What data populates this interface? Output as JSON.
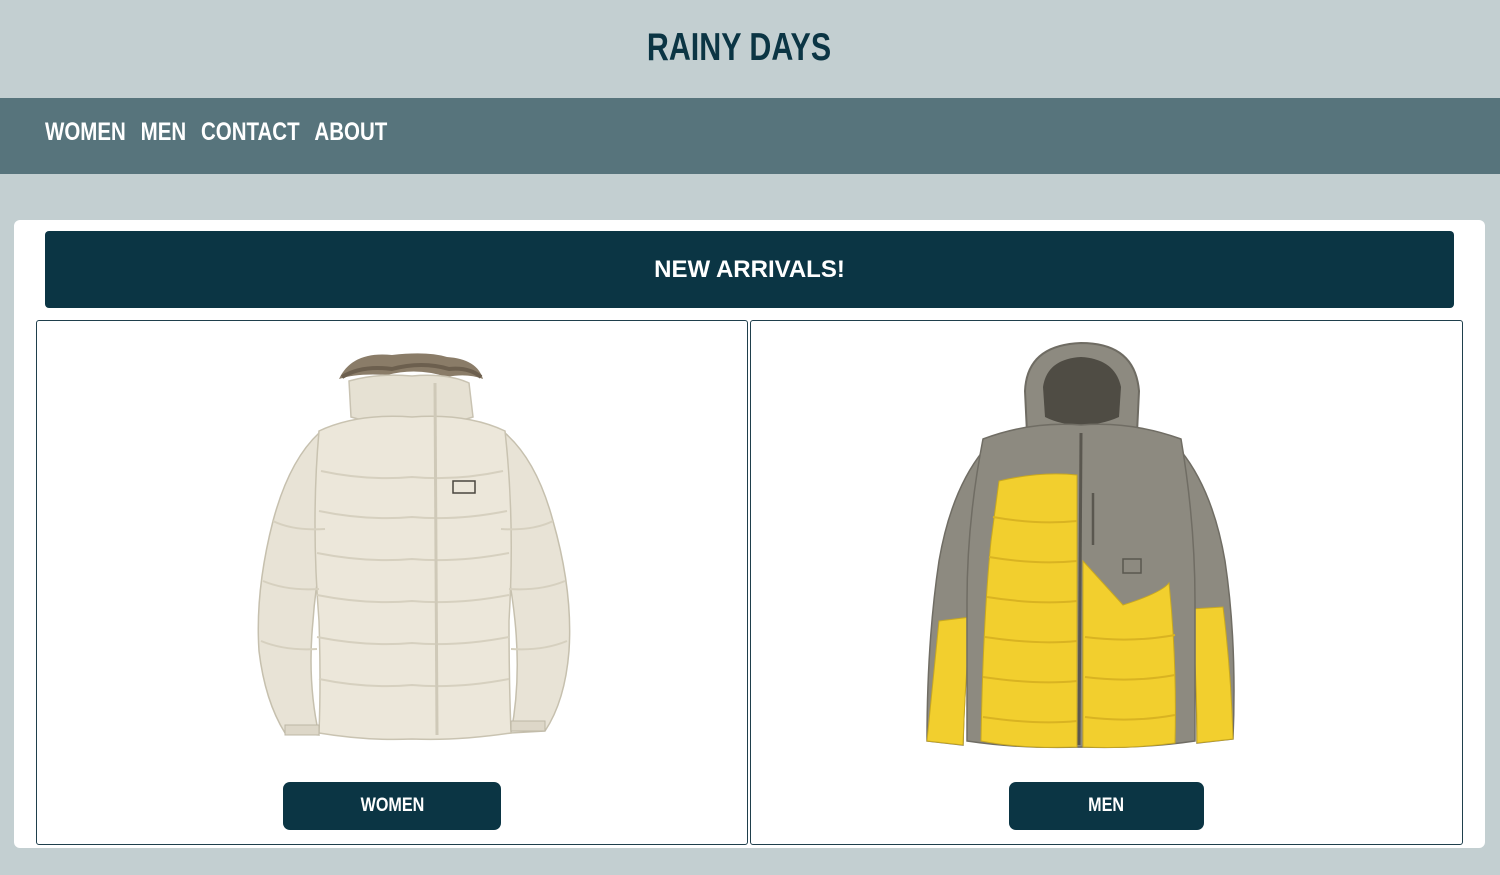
{
  "header": {
    "site_title": "RAINY DAYS"
  },
  "nav": {
    "items": [
      {
        "label": "WOMEN"
      },
      {
        "label": "MEN"
      },
      {
        "label": "CONTACT"
      },
      {
        "label": "ABOUT"
      }
    ]
  },
  "banner": {
    "title": "NEW ARRIVALS!"
  },
  "products": [
    {
      "category": "women",
      "button_label": "WOMEN",
      "image": "cream-womens-puffer-jacket",
      "colors": {
        "body": "#ebe6d9",
        "fur": "#8a7c68"
      }
    },
    {
      "category": "men",
      "button_label": "MEN",
      "image": "yellow-grey-mens-puffer-jacket",
      "colors": {
        "body": "#f2cf2e",
        "trim": "#8d8a80"
      }
    }
  ],
  "colors": {
    "page_background": "#c3cfd1",
    "nav_background": "#57747c",
    "primary_dark": "#0b3544",
    "panel_background": "#ffffff"
  }
}
